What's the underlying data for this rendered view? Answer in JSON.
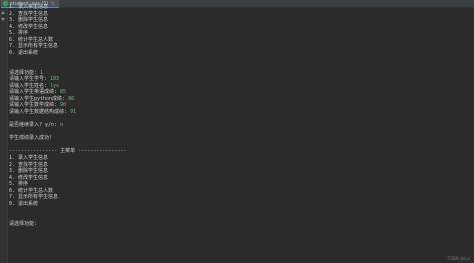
{
  "tab": {
    "title": "student_sys (1)",
    "close": "×"
  },
  "console_lines": [
    {
      "t": "1. 录入学生信息"
    },
    {
      "t": "2. 查找学生信息"
    },
    {
      "t": "3. 删除学生信息"
    },
    {
      "t": "4. 修改学生信息"
    },
    {
      "t": "5. 排序"
    },
    {
      "t": "6. 统计学生总人数"
    },
    {
      "t": "7. 显示所有学生信息"
    },
    {
      "t": "0. 退出系统"
    },
    {
      "t": ""
    },
    {
      "t": ""
    },
    {
      "t": "请选择功能: ",
      "in": "1"
    },
    {
      "t": "请输入学生学号: ",
      "in": "103"
    },
    {
      "t": "请输入学生姓名: ",
      "in": "lyx"
    },
    {
      "t": "请输入学生英语成绩: ",
      "in": "85"
    },
    {
      "t": "请输入学生python成绩: ",
      "in": "86"
    },
    {
      "t": "请输入学生数学成绩: ",
      "in": "90"
    },
    {
      "t": "请输入学生数据结构成绩: ",
      "in": "91"
    },
    {
      "t": ""
    },
    {
      "t": "是否继续录入? y/n: ",
      "in": "n"
    },
    {
      "t": ""
    },
    {
      "t": "学生成绩录入成功!"
    },
    {
      "t": ""
    },
    {
      "t": "---------------- 主菜单 ----------------"
    },
    {
      "t": "1. 录入学生信息"
    },
    {
      "t": "2. 查找学生信息"
    },
    {
      "t": "3. 删除学生信息"
    },
    {
      "t": "4. 修改学生信息"
    },
    {
      "t": "5. 排序"
    },
    {
      "t": "6. 统计学生总人数"
    },
    {
      "t": "7. 显示所有学生信息"
    },
    {
      "t": "0. 退出系统"
    },
    {
      "t": ""
    },
    {
      "t": ""
    },
    {
      "t": "请选择功能: "
    }
  ],
  "watermark": "CSDN @lyx"
}
